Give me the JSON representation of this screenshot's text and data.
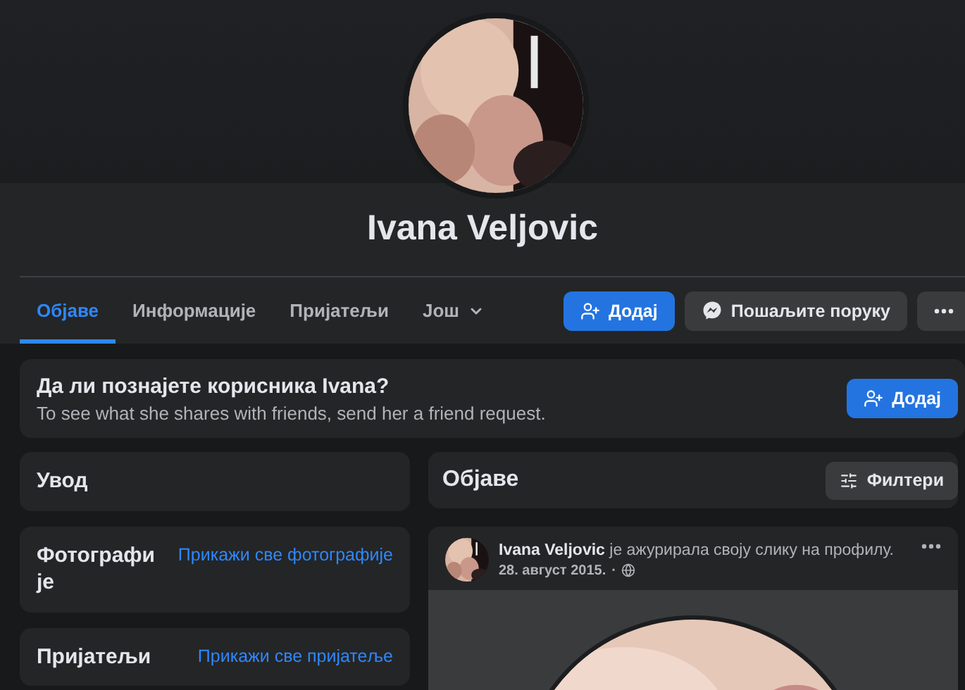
{
  "profile": {
    "name": "Ivana Veljovic"
  },
  "tabs": [
    {
      "label": "Објаве",
      "selected": true
    },
    {
      "label": "Информације",
      "selected": false
    },
    {
      "label": "Пријатељи",
      "selected": false
    },
    {
      "label": "Још",
      "selected": false,
      "dropdown": true
    }
  ],
  "actions": {
    "add": "Додај",
    "message": "Пошаљите поруку"
  },
  "banner": {
    "title": "Да ли познајете корисника Ivana?",
    "text": "To see what she shares with friends, send her a friend request.",
    "button": "Додај"
  },
  "sidebar": [
    {
      "title": "Увод"
    },
    {
      "title": "Фотографије",
      "link": "Прикажи све фотографије"
    },
    {
      "title": "Пријатељи",
      "link": "Прикажи све пријатеље"
    }
  ],
  "posts_header": {
    "title": "Објаве",
    "filter": "Филтери"
  },
  "post": {
    "author": "Ivana Veljovic",
    "action": "је ажурирала своју слику на профилу.",
    "date": "28. август 2015.",
    "separator": "·"
  }
}
